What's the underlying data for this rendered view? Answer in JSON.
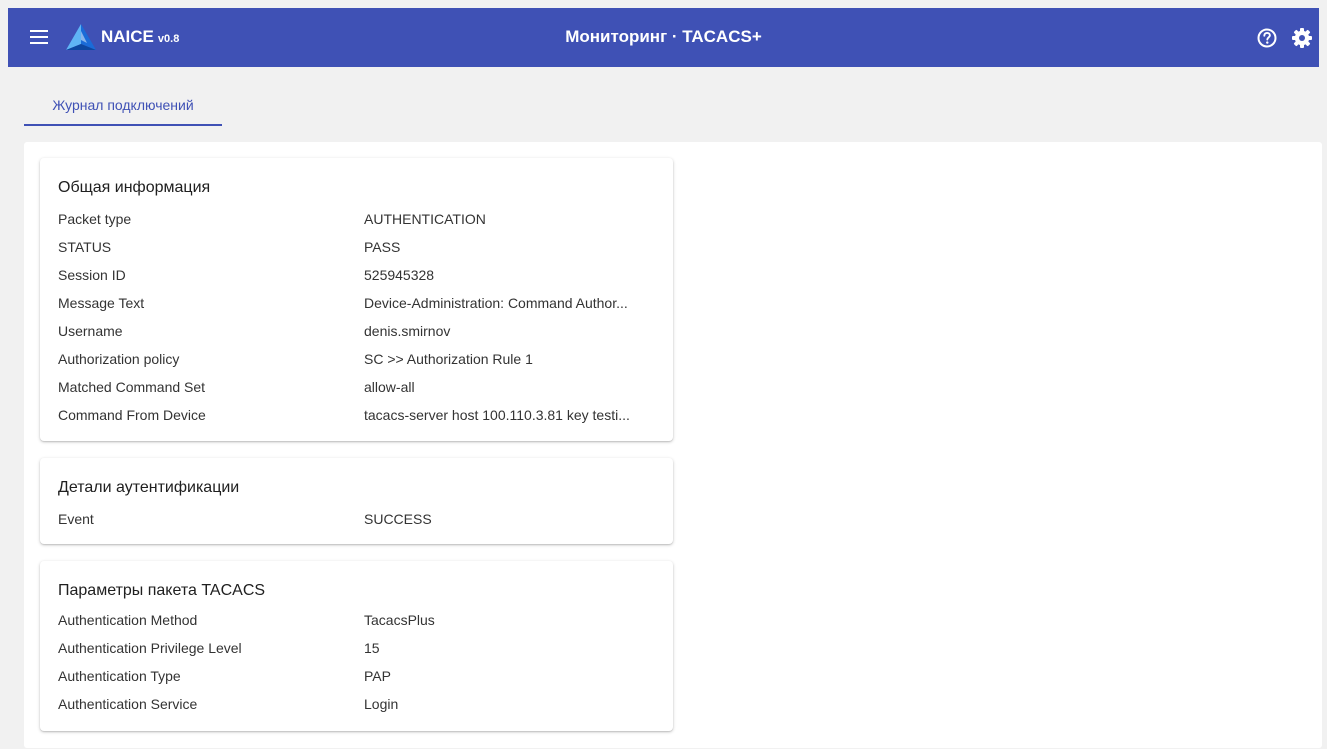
{
  "header": {
    "app_name": "NAICE",
    "version": "v0.8",
    "title": "Мониторинг · TACACS+",
    "brand_color": "#3f51b5",
    "icons": [
      "menu-icon",
      "naice-logo",
      "help-circle-icon",
      "gear-icon"
    ]
  },
  "tabs": [
    {
      "label": "Журнал подключений",
      "active": true
    }
  ],
  "sections": {
    "general": {
      "title": "Общая информация",
      "rows": [
        {
          "key": "Packet type",
          "value": "AUTHENTICATION"
        },
        {
          "key": "STATUS",
          "value": "PASS"
        },
        {
          "key": "Session ID",
          "value": "525945328"
        },
        {
          "key": "Message Text",
          "value": "Device-Administration: Command Author..."
        },
        {
          "key": "Username",
          "value": "denis.smirnov"
        },
        {
          "key": "Authorization policy",
          "value": "SC >> Authorization Rule 1"
        },
        {
          "key": "Matched Command Set",
          "value": "allow-all"
        },
        {
          "key": "Command From Device",
          "value": "tacacs-server host 100.110.3.81 key testi..."
        }
      ]
    },
    "auth_details": {
      "title": "Детали аутентификации",
      "rows": [
        {
          "key": "Event",
          "value": "SUCCESS"
        }
      ]
    },
    "tacacs_params": {
      "title": "Параметры пакета TACACS",
      "rows": [
        {
          "key": "Authentication Method",
          "value": "TacacsPlus"
        },
        {
          "key": "Authentication Privilege Level",
          "value": "15"
        },
        {
          "key": "Authentication Type",
          "value": "PAP"
        },
        {
          "key": "Authentication Service",
          "value": "Login"
        }
      ]
    }
  }
}
